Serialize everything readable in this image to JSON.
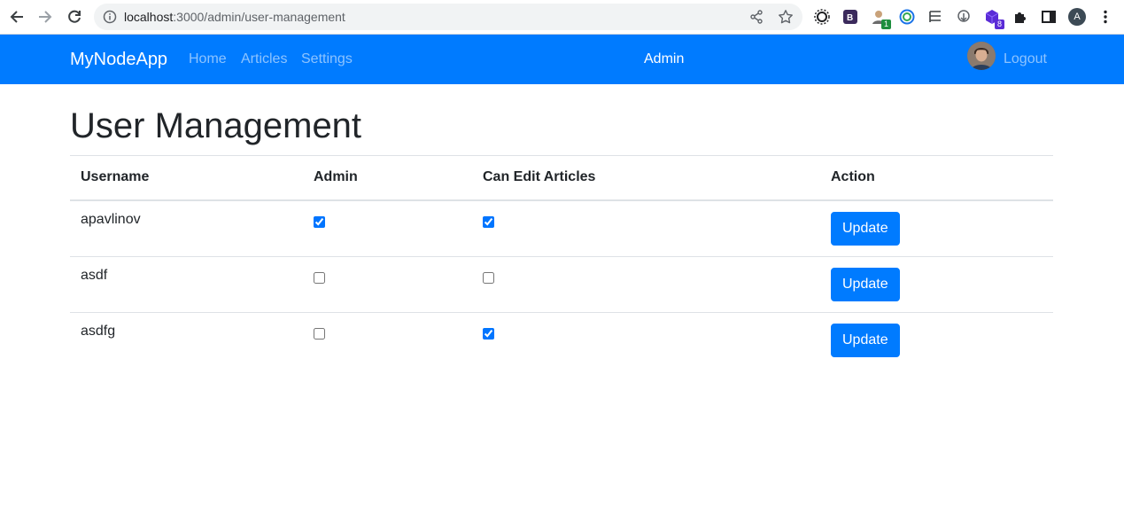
{
  "browser": {
    "url_host": "localhost",
    "url_rest": ":3000/admin/user-management",
    "extension_badges": [
      "1",
      "8"
    ],
    "profile_initial": "A"
  },
  "navbar": {
    "brand": "MyNodeApp",
    "links": [
      "Home",
      "Articles",
      "Settings"
    ],
    "center_label": "Admin",
    "logout_label": "Logout",
    "color": "#007bff"
  },
  "page": {
    "title": "User Management"
  },
  "table": {
    "headers": [
      "Username",
      "Admin",
      "Can Edit Articles",
      "Action"
    ],
    "rows": [
      {
        "username": "apavlinov",
        "admin": true,
        "can_edit": true,
        "action": "Update"
      },
      {
        "username": "asdf",
        "admin": false,
        "can_edit": false,
        "action": "Update"
      },
      {
        "username": "asdfg",
        "admin": false,
        "can_edit": true,
        "action": "Update"
      }
    ]
  }
}
